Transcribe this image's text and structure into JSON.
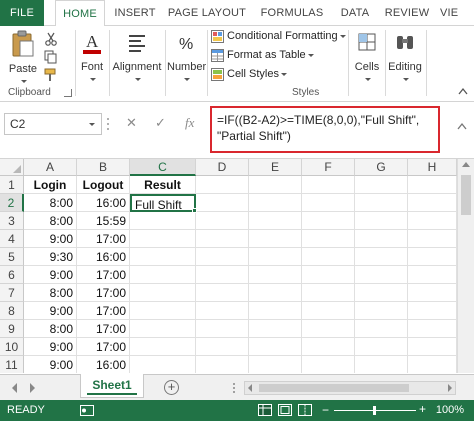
{
  "ribbon_tabs": [
    "FILE",
    "HOME",
    "INSERT",
    "PAGE LAYOUT",
    "FORMULAS",
    "DATA",
    "REVIEW",
    "VIE"
  ],
  "active_tab": "HOME",
  "ribbon": {
    "clipboard": {
      "paste_label": "Paste",
      "group_label": "Clipboard"
    },
    "font_label": "Font",
    "alignment_label": "Alignment",
    "number_label": "Number",
    "styles": {
      "conditional": "Conditional Formatting",
      "table": "Format as Table",
      "cell_styles": "Cell Styles",
      "group_label": "Styles"
    },
    "cells_label": "Cells",
    "editing_label": "Editing"
  },
  "formula_bar": {
    "name_box": "C2",
    "cancel": "✕",
    "enter": "✓",
    "fx": "fx",
    "formula_line1": "=IF((B2-A2)>=TIME(8,0,0),\"Full Shift\",",
    "formula_line2": "\"Partial Shift\")"
  },
  "grid": {
    "columns": [
      "A",
      "B",
      "C",
      "D",
      "E",
      "F",
      "G",
      "H"
    ],
    "rows": [
      "1",
      "2",
      "3",
      "4",
      "5",
      "6",
      "7",
      "8",
      "9",
      "10",
      "11"
    ],
    "headers": {
      "a": "Login",
      "b": "Logout",
      "c": "Result"
    },
    "data": [
      {
        "a": "8:00",
        "b": "16:00",
        "c": "Full Shift"
      },
      {
        "a": "8:00",
        "b": "15:59",
        "c": ""
      },
      {
        "a": "9:00",
        "b": "17:00",
        "c": ""
      },
      {
        "a": "9:30",
        "b": "16:00",
        "c": ""
      },
      {
        "a": "9:00",
        "b": "17:00",
        "c": ""
      },
      {
        "a": "8:00",
        "b": "17:00",
        "c": ""
      },
      {
        "a": "9:00",
        "b": "17:00",
        "c": ""
      },
      {
        "a": "8:00",
        "b": "17:00",
        "c": ""
      },
      {
        "a": "9:00",
        "b": "17:00",
        "c": ""
      },
      {
        "a": "9:00",
        "b": "16:00",
        "c": ""
      }
    ]
  },
  "sheet_tabs": [
    "Sheet1"
  ],
  "add_sheet": "+",
  "status": {
    "text": "READY",
    "zoom": "100%"
  },
  "colors": {
    "accent": "#217346",
    "formula_highlight": "#d9272e"
  }
}
